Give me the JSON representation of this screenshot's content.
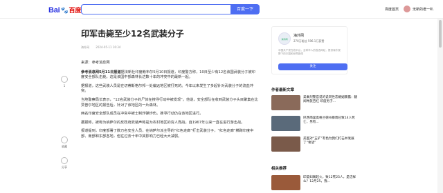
{
  "header": {
    "logo_main": "Bai",
    "logo_paw": "🐾",
    "logo_cn": "百度",
    "search_button": "百度一下",
    "home_link": "百度首页",
    "user_name": "无新的老一叭"
  },
  "article": {
    "title": "印军击毙至少12名武装分子",
    "source": "海外网",
    "date": "2024-05-11 16:34",
    "origin": "来源：参考消息网",
    "lead_bold": "参考消息网5月11日报道",
    "lead_rest": "据法新社印度赖布尔5月10日报道，印度警方称，10日至少有12名该国武装分子被印度安全部队击毙。这是该国中部森林长达数十年的冲突中的最新一起。",
    "paragraphs": [
      "据报道，这些武装人员是在切蒂斯格尔邦一处偏远地区被打死的。今年以来发生了多起针对武装分子的流血冲突。",
      "当地警察局长表示，“12名武装分子的尸体在搜寻行动中被发现”。他说，安全部队在收到武装分子头目聚集在比贾普尔地区的报告后，针对了该地区的一片森林。",
      "两名印度安全部队成员在冲突中被士制炸弹炸伤。搜寻行动仍在该地区进行。",
      "据报称，被称为纳萨尔的反政府武装声称是为农村地区的穷人而战，自1967年以来一直在进行游击战。",
      "报道提到，印度部署了数万名安全人员，在纳萨尔派主导的“红色走廊”打击武装分子，“红色走廊”横跨印度中部、南部和东部各地，但在过去十年中其影响力已经大大减弱。"
    ]
  },
  "side_actions": [
    {
      "icon": "thumb-up-icon",
      "label": "1"
    },
    {
      "icon": "star-icon",
      "label": "收藏"
    },
    {
      "icon": "share-icon",
      "label": "分享"
    }
  ],
  "author_card": {
    "avatar_text": "海外网",
    "name": "海外网",
    "stats": "270万粉丝 596.1万获赞",
    "desc": "中国共产党在线平台，全球华人的首选网站，提供海外视野下的中国和世界新闻",
    "follow": "关注"
  },
  "related": {
    "title": "作者最新文章",
    "items": [
      {
        "text": "美乘烈警官说的说同性恋婚姻暴露：翻阅种族否红 印度男子...",
        "color": "#8a6a5a"
      },
      {
        "text": "巴西南里奥格兰德州暴雨已致14人死亡，另有...",
        "color": "#5a6a7a"
      },
      {
        "text": "美国对“五矿”有色为我们打击并发展了“希望”",
        "color": "#7a5a4a"
      }
    ]
  },
  "hot": {
    "title": "相关推荐",
    "items": [
      {
        "text": "印度妇联起火，致12死25人，是这样么？12月25，我...",
        "color": "#9a5a3a"
      }
    ]
  },
  "colors": {
    "accent": "#4e6ef2",
    "brand_red": "#e10602"
  }
}
